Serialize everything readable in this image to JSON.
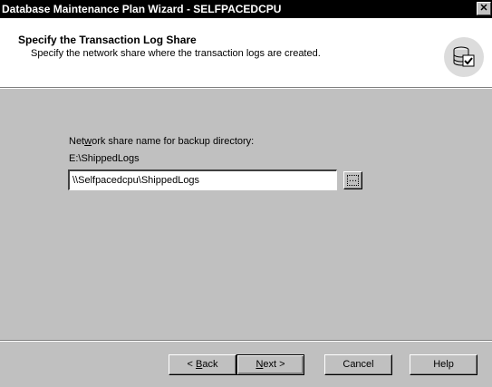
{
  "window": {
    "title": "Database Maintenance Plan Wizard - SELFPACEDCPU",
    "close_glyph": "✕"
  },
  "header": {
    "title": "Specify the Transaction Log Share",
    "subtitle": "Specify the network share where the transaction logs are created.",
    "icon": "database-check-icon"
  },
  "form": {
    "label_before": "Net",
    "label_mnemonic": "w",
    "label_after": "ork share name for backup directory:",
    "path": "E:\\ShippedLogs",
    "share_value": "\\\\Selfpacedcpu\\ShippedLogs",
    "browse_label": "..."
  },
  "buttons": {
    "back_prefix": "< ",
    "back_mnemonic": "B",
    "back_rest": "ack",
    "next_mnemonic": "N",
    "next_rest": "ext >",
    "cancel": "Cancel",
    "help": "Help"
  }
}
